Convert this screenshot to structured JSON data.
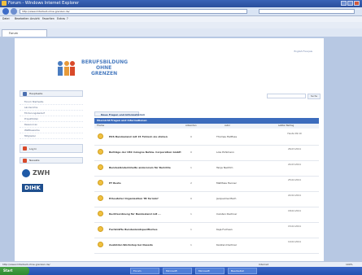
{
  "window": {
    "title": "Forum - Windows Internet Explorer",
    "url": "http://www.mitarbeit-ohne-grenzen.de/"
  },
  "menu": [
    "Datei",
    "Bearbeiten",
    "Ansicht",
    "Favoriten",
    "Extras",
    "?"
  ],
  "tabs": [
    {
      "label": "Forum"
    }
  ],
  "site": {
    "brand_line1": "BERUFSBILDUNG",
    "brand_line2": "OHNE",
    "brand_line3": "GRENZEN",
    "lang": "English Français"
  },
  "sidebar": {
    "buttons": [
      {
        "label": "Hauptseite"
      }
    ],
    "links": [
      "Forum Startseite",
      "Länderinfos",
      "Förderungsbedarf",
      "Projektlisten",
      "Ressourcen",
      "Wettbewerbe",
      "Mitglieder"
    ],
    "login_label": "Log In",
    "news_label": "Neueste",
    "partners": [
      "ZWH",
      "DIHK"
    ]
  },
  "main": {
    "search_btn": "Suche",
    "section_title": "Neue Fragen und Informationen",
    "table_header": "Übersicht Fragen und Informationen",
    "cols": [
      "Thema",
      "Antworten",
      "Autor",
      "Letzter Beitrag"
    ],
    "rows": [
      {
        "title": "EOS Bundesland mit 15 Fehlern sie stehen",
        "replies": "0",
        "author": "Thomas Haltfuss",
        "last": "Heute 09:10"
      },
      {
        "title": "Beiträge der CBC Cologne Netzw. Corporation GmbH",
        "replies": "0",
        "author": "Lola Pohlmann",
        "last": "26.03.2011"
      },
      {
        "title": "Bundesländerinhalte andersrum für Berichte",
        "replies": "1",
        "author": "Tanja Nachtm",
        "last": "24.03.2011"
      },
      {
        "title": "ET Beste",
        "replies": "2",
        "author": "Matthias Henner",
        "last": "25.02.2011"
      },
      {
        "title": "Erbeuteter Organisation TB Termin?",
        "replies": "0",
        "author": "Jacqueline Mach",
        "last": "22.02.2011"
      },
      {
        "title": "Rechtsordnung für Bundesland mit ...",
        "replies": "1",
        "author": "Carsten Dachner",
        "last": "18.02.2011"
      },
      {
        "title": "Fachkräfte Bundeslandspezifisches",
        "replies": "1",
        "author": "Kaja Fuchsen",
        "last": "15.02.2011"
      },
      {
        "title": "Ausbilder-Workshop bei Dasaiio",
        "replies": "1",
        "author": "Karsten Dachner",
        "last": "10.02.2011"
      }
    ]
  },
  "status": {
    "url": "http://www.mitarbeit-ohne-grenzen.de/",
    "zone": "Internet",
    "zoom": "100%"
  },
  "taskbar": {
    "start": "Start",
    "items": [
      "Forum",
      "Microsoft",
      "Microsoft",
      "Bearbeitet"
    ]
  }
}
